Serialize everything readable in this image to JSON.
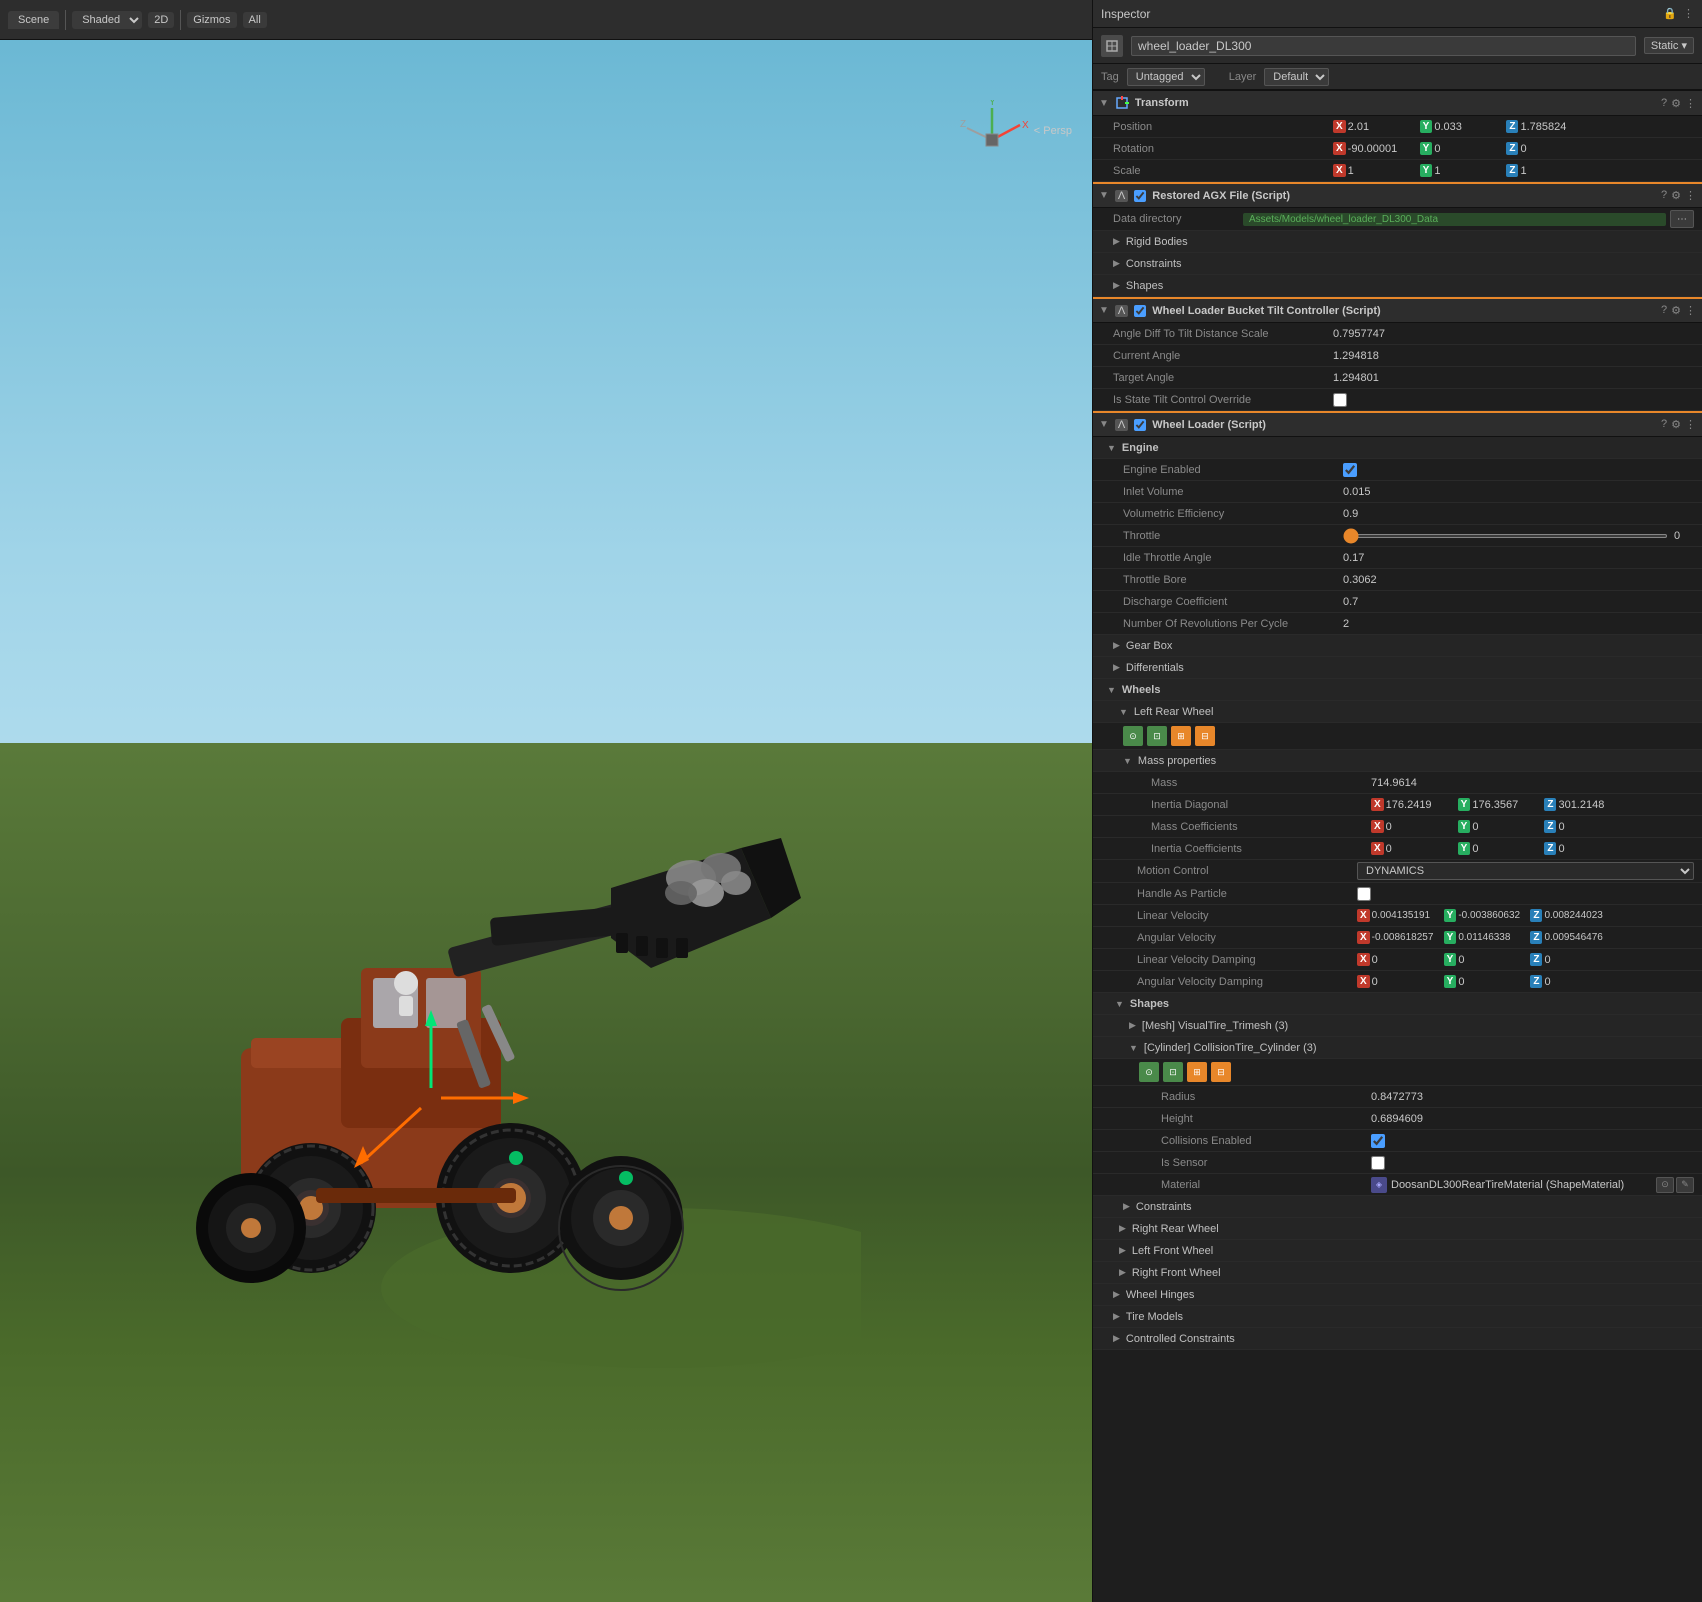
{
  "scene": {
    "tab_label": "Scene",
    "shading": "Shaded",
    "mode_2d": "2D",
    "gizmos": "Gizmos",
    "all": "All",
    "persp_label": "< Persp"
  },
  "inspector": {
    "title": "Inspector",
    "object_name": "wheel_loader_DL300",
    "static_label": "Static ▾",
    "tag_label": "Tag",
    "tag_value": "Untagged",
    "layer_label": "Layer",
    "layer_value": "Default",
    "transform": {
      "title": "Transform",
      "position_label": "Position",
      "px": "2.01",
      "py": "0.033",
      "pz": "1.785824",
      "rotation_label": "Rotation",
      "rx": "-90.00001",
      "ry": "0",
      "rz": "0",
      "scale_label": "Scale",
      "sx": "1",
      "sy": "1",
      "sz": "1"
    },
    "restored_agx": {
      "title": "Restored AGX File (Script)",
      "data_dir_label": "Data directory",
      "data_dir_value": "Assets/Models/wheel_loader_DL300_Data"
    },
    "rigid_bodies": {
      "title": "Rigid Bodies"
    },
    "constraints": {
      "title": "Constraints"
    },
    "shapes": {
      "title": "Shapes"
    },
    "bucket_tilt": {
      "title": "Wheel Loader Bucket Tilt Controller (Script)",
      "angle_diff_label": "Angle Diff To Tilt Distance Scale",
      "angle_diff_value": "0.7957747",
      "current_angle_label": "Current Angle",
      "current_angle_value": "1.294818",
      "target_angle_label": "Target Angle",
      "target_angle_value": "1.294801",
      "is_state_label": "Is State Tilt Control Override"
    },
    "wheel_loader": {
      "title": "Wheel Loader (Script)",
      "engine_section": "Engine",
      "engine_enabled_label": "Engine Enabled",
      "inlet_volume_label": "Inlet Volume",
      "inlet_volume_value": "0.015",
      "volumetric_eff_label": "Volumetric Efficiency",
      "volumetric_eff_value": "0.9",
      "throttle_label": "Throttle",
      "throttle_value": "0",
      "idle_throttle_label": "Idle Throttle Angle",
      "idle_throttle_value": "0.17",
      "throttle_bore_label": "Throttle Bore",
      "throttle_bore_value": "0.3062",
      "discharge_coeff_label": "Discharge Coefficient",
      "discharge_coeff_value": "0.7",
      "num_revolutions_label": "Number Of Revolutions Per Cycle",
      "num_revolutions_value": "2",
      "gear_box_section": "Gear Box",
      "differentials_section": "Differentials",
      "wheels_section": "Wheels",
      "left_rear_wheel": "Left Rear Wheel",
      "mass_properties_section": "Mass properties",
      "mass_label": "Mass",
      "mass_value": "714.9614",
      "inertia_diagonal_label": "Inertia Diagonal",
      "inertia_diagonal_x": "176.2419",
      "inertia_diagonal_y": "176.3567",
      "inertia_diagonal_z": "301.2148",
      "mass_coeff_label": "Mass Coefficients",
      "mass_coeff_x": "0",
      "mass_coeff_y": "0",
      "mass_coeff_z": "0",
      "inertia_coeff_label": "Inertia Coefficients",
      "inertia_coeff_x": "0",
      "inertia_coeff_y": "0",
      "inertia_coeff_z": "0",
      "motion_control_label": "Motion Control",
      "motion_control_value": "DYNAMICS",
      "handle_as_particle_label": "Handle As Particle",
      "linear_velocity_label": "Linear Velocity",
      "linear_velocity_x": "0.004135191",
      "linear_velocity_y": "-0.003860632",
      "linear_velocity_z": "0.008244023",
      "angular_velocity_label": "Angular Velocity",
      "angular_velocity_x": "-0.008618257",
      "angular_velocity_y": "0.01146338",
      "angular_velocity_z": "0.009546476",
      "linear_vel_damping_label": "Linear Velocity Damping",
      "linear_vel_damping_x": "0",
      "linear_vel_damping_y": "0",
      "linear_vel_damping_z": "0",
      "angular_vel_damping_label": "Angular Velocity Damping",
      "angular_vel_damping_x": "0",
      "angular_vel_damping_y": "0",
      "angular_vel_damping_z": "0",
      "shapes_section": "Shapes",
      "mesh_visual": "[Mesh] VisualTire_Trimesh (3)",
      "cylinder_collision": "[Cylinder] CollisionTire_Cylinder (3)",
      "radius_label": "Radius",
      "radius_value": "0.8472773",
      "height_label": "Height",
      "height_value": "0.6894609",
      "collisions_enabled_label": "Collisions Enabled",
      "is_sensor_label": "Is Sensor",
      "material_label": "Material",
      "material_value": "DoosanDL300RearTireMaterial (ShapeMaterial)",
      "constraints_section": "Constraints",
      "right_rear_wheel": "Right Rear Wheel",
      "left_front_wheel": "Left Front Wheel",
      "right_front_wheel": "Right Front Wheel",
      "wheel_hinges_section": "Wheel Hinges",
      "tire_models_section": "Tire Models",
      "controlled_constraints_section": "Controlled Constraints"
    }
  }
}
